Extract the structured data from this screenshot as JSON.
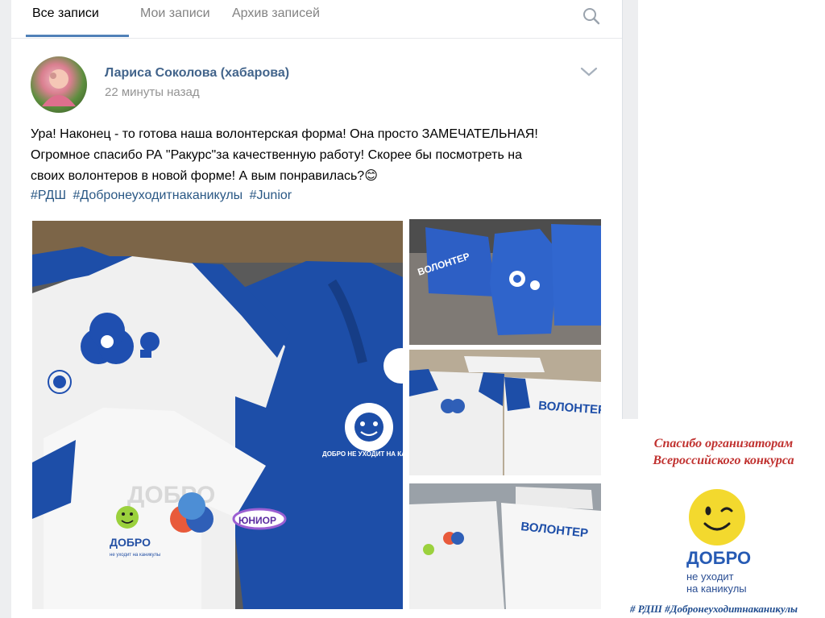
{
  "tabs": {
    "all_posts": "Все записи",
    "my_posts": "Мои записи",
    "archive": "Архив записей"
  },
  "post": {
    "author": "Лариса Соколова (хабарова)",
    "time": "22 минуты назад",
    "text_lines": [
      "Ура! Наконец - то готова наша волонтерская форма! Она просто ЗАМЕЧАТЕЛЬНАЯ!",
      "Огромное спасибо РА \"Ракурс\"за качественную работу! Скорее бы посмотреть на",
      "своих волонтеров в новой форме! А вым понравилась?😊"
    ],
    "hashtags": [
      "#РДШ",
      "#Добронеуходитнаканикулы",
      "#Junior"
    ]
  },
  "photos": {
    "main": {
      "logo_word": "ДОБРО",
      "logo_sub": "не уходит на каникулы",
      "ring_text": "ДОБРО НЕ УХОДИТ НА КАНИКУЛЫ",
      "tag_text": "ЮНИОР",
      "badge_text": "ДОБРО"
    },
    "top_right": {
      "label": "ВОЛОНТЕР"
    },
    "mid_right": {
      "label": "ВОЛОНТЕР"
    },
    "bottom_right": {
      "label": "ВОЛОНТЕР"
    }
  },
  "promo": {
    "title_line1": "Спасибо организаторам",
    "title_line2": "Всероссийского конкурса",
    "brand_word": "ДОБРО",
    "brand_sub_line1": "не уходит",
    "brand_sub_line2": "на каникулы",
    "tags": "# РДШ #Добронеуходитнаканикулы"
  },
  "colors": {
    "link": "#2a5885",
    "author": "#42648b",
    "accent": "#5181b8",
    "jacket_blue": "#1e4fb0",
    "promo_red": "#c0312f",
    "brand_blue": "#275bb4",
    "smiley_yellow": "#f3d92e"
  },
  "icons": {
    "search": "search-icon",
    "chevron": "chevron-down-icon",
    "smiley": "smiley-icon"
  }
}
